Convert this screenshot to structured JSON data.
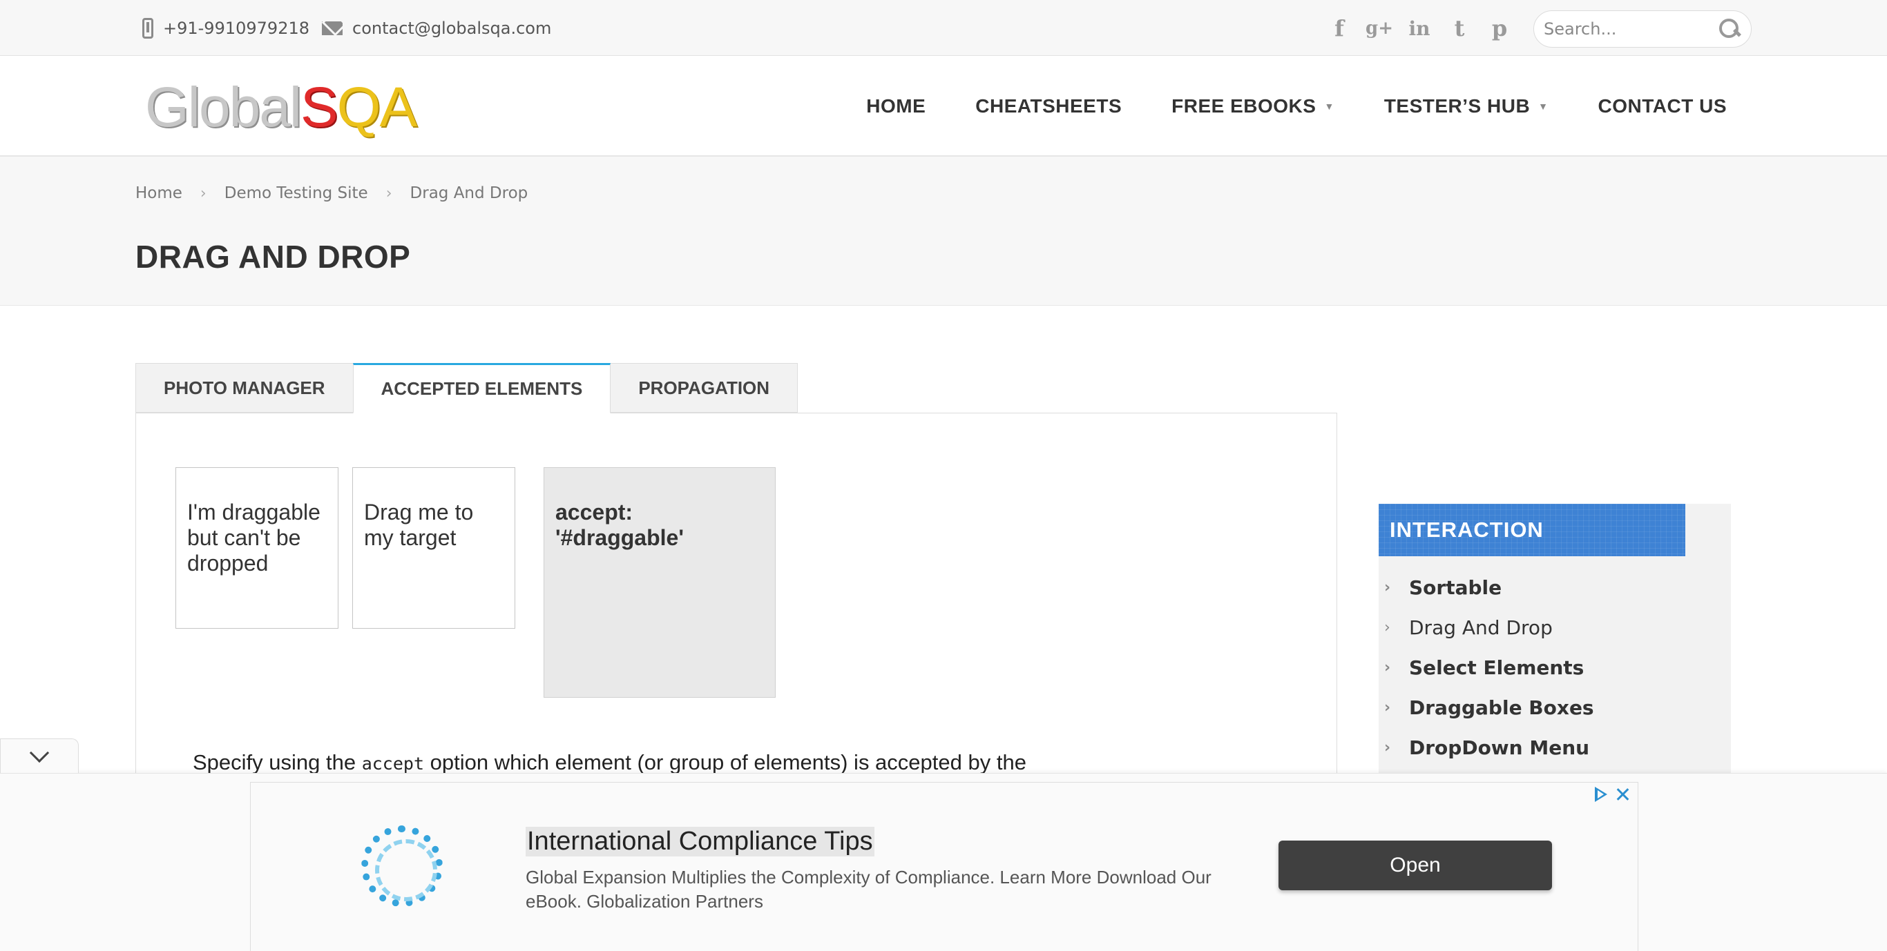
{
  "topbar": {
    "phone": "+91-9910979218",
    "email": "contact@globalsqa.com",
    "social": [
      {
        "icon": "facebook-icon",
        "glyph": "f"
      },
      {
        "icon": "google-plus-icon",
        "glyph": "g+"
      },
      {
        "icon": "linkedin-icon",
        "glyph": "in"
      },
      {
        "icon": "twitter-icon",
        "glyph": "t"
      },
      {
        "icon": "pinterest-icon",
        "glyph": "p"
      }
    ],
    "search_placeholder": "Search..."
  },
  "header": {
    "logo": {
      "part1": "Global",
      "part2": "S",
      "part3": "QA"
    },
    "nav": {
      "home": "HOME",
      "cheatsheets": "CHEATSHEETS",
      "free_ebooks": "FREE EBOOKS",
      "testers_hub": "TESTER’S HUB",
      "contact_us": "CONTACT US"
    }
  },
  "breadcrumb": {
    "home": "Home",
    "demo": "Demo Testing Site",
    "current": "Drag And Drop",
    "separator": "›"
  },
  "page_title": "DRAG AND DROP",
  "tabs": {
    "photo_manager": "PHOTO MANAGER",
    "accepted_elements": "ACCEPTED ELEMENTS",
    "propagation": "PROPAGATION",
    "active": "ACCEPTED ELEMENTS"
  },
  "demo": {
    "non_valid_box": "I'm draggable but can't be dropped",
    "draggable_box": "Drag me to my target",
    "droppable_box": "accept: '#draggable'",
    "description_pre": "Specify using the ",
    "description_code": "accept",
    "description_post": " option which element (or group of elements) is accepted by the"
  },
  "sidebar": {
    "heading": "INTERACTION",
    "items": [
      {
        "label": "Sortable",
        "bold": true
      },
      {
        "label": "Drag And Drop",
        "bold": false
      },
      {
        "label": "Select Elements",
        "bold": true
      },
      {
        "label": "Draggable Boxes",
        "bold": true
      },
      {
        "label": "DropDown Menu",
        "bold": true
      }
    ]
  },
  "ad": {
    "title": "International Compliance Tips",
    "body": "Global Expansion Multiplies the Complexity of Compliance. Learn More Download Our eBook. Globalization Partners",
    "button": "Open"
  },
  "colors": {
    "accent_tab": "#29a8e0",
    "sidebar_head": "#3e82d4",
    "logo_s": "#e02a2a",
    "logo_qa": "#ecc21b"
  }
}
